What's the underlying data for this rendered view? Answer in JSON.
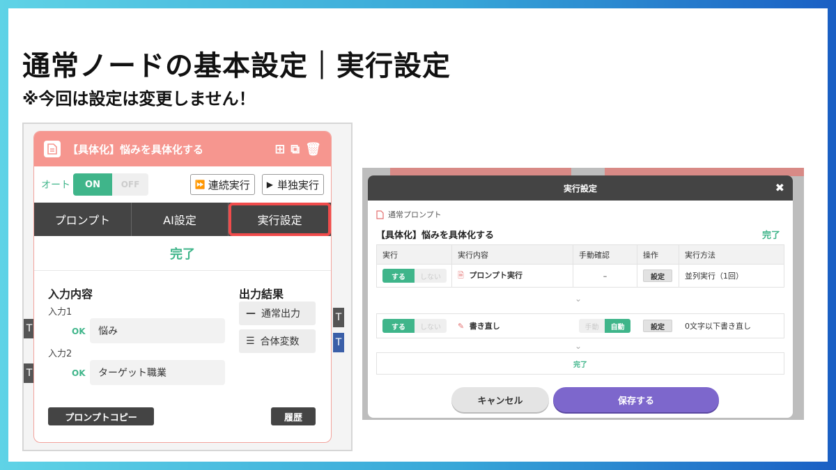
{
  "slide": {
    "title": "通常ノードの基本設定｜実行設定",
    "subtitle": "※今回は設定は変更しません！"
  },
  "left_node": {
    "name": "【具体化】悩みを具体化する",
    "auto_label": "オート",
    "toggle_on": "ON",
    "toggle_off": "OFF",
    "run_continuous": "連続実行",
    "run_single": "単独実行",
    "tabs": [
      "プロンプト",
      "AI設定",
      "実行設定"
    ],
    "status": "完了",
    "input_heading": "入力内容",
    "inputs": [
      {
        "label": "入力1",
        "ok": "OK",
        "value": "悩み"
      },
      {
        "label": "入力2",
        "ok": "OK",
        "value": "ターゲット職業"
      }
    ],
    "output_heading": "出力結果",
    "outputs": [
      "通常出力",
      "合体変数"
    ],
    "copy_button": "プロンプトコピー",
    "history_button": "履歴",
    "edge_letter": "T"
  },
  "modal": {
    "title": "実行設定",
    "close_icon": "close-icon",
    "crumb": "通常プロンプト",
    "node_name": "【具体化】悩みを具体化する",
    "status": "完了",
    "columns": [
      "実行",
      "実行内容",
      "手動確認",
      "操作",
      "実行方法"
    ],
    "steps": [
      {
        "do": "する",
        "dont": "しない",
        "content": "プロンプト実行",
        "manual": "–",
        "op": "設定",
        "method": "並列実行（1回）"
      },
      {
        "do": "する",
        "dont": "しない",
        "content": "書き直し",
        "manual_off": "手動",
        "manual_on": "自動",
        "op": "設定",
        "method": "0文字以下書き直し"
      }
    ],
    "final": "完了",
    "cancel": "キャンセル",
    "save": "保存する"
  },
  "colors": {
    "accent_green": "#3fb58a",
    "node_header": "#f6968f",
    "highlight_red": "#f04b4b",
    "save_purple": "#7d67cc"
  }
}
